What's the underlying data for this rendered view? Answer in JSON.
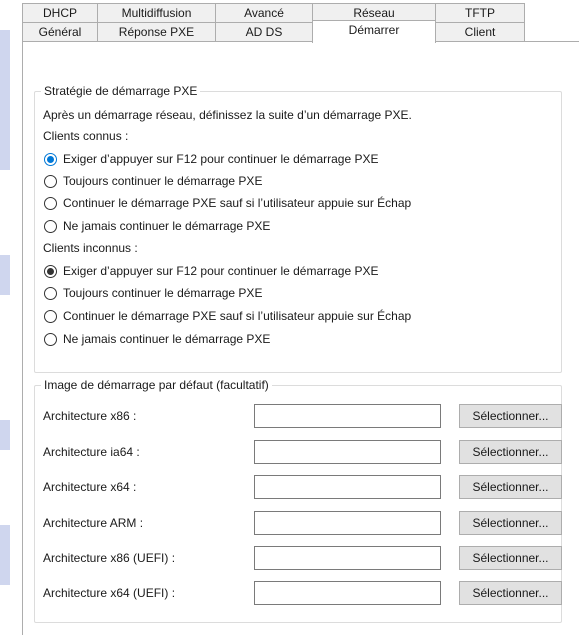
{
  "tabs": {
    "back_row": [
      "DHCP",
      "Multidiffusion",
      "Avancé",
      "Réseau",
      "TFTP"
    ],
    "front_row": [
      "Général",
      "Réponse PXE",
      "AD DS",
      "Démarrer",
      "Client"
    ],
    "selected": "Démarrer"
  },
  "pxe_strategy": {
    "title": "Stratégie de démarrage PXE",
    "description": "Après un démarrage réseau, définissez la suite d’un démarrage PXE.",
    "known_clients": {
      "label": "Clients connus :",
      "options": [
        {
          "label": "Exiger d’appuyer sur F12 pour continuer le démarrage PXE",
          "checked": true
        },
        {
          "label": "Toujours continuer le démarrage PXE",
          "checked": false
        },
        {
          "label": "Continuer le démarrage PXE sauf si l’utilisateur appuie sur Échap",
          "checked": false
        },
        {
          "label": "Ne jamais continuer le démarrage PXE",
          "checked": false
        }
      ]
    },
    "unknown_clients": {
      "label": "Clients inconnus :",
      "options": [
        {
          "label": "Exiger d’appuyer sur F12 pour continuer le démarrage PXE",
          "checked": true
        },
        {
          "label": "Toujours continuer le démarrage PXE",
          "checked": false
        },
        {
          "label": "Continuer le démarrage PXE sauf si l’utilisateur appuie sur Échap",
          "checked": false
        },
        {
          "label": "Ne jamais continuer le démarrage PXE",
          "checked": false
        }
      ]
    }
  },
  "default_image": {
    "title": "Image de démarrage par défaut (facultatif)",
    "rows": [
      {
        "label": "Architecture x86 :",
        "value": "",
        "button": "Sélectionner..."
      },
      {
        "label": "Architecture ia64 :",
        "value": "",
        "button": "Sélectionner..."
      },
      {
        "label": "Architecture x64 :",
        "value": "",
        "button": "Sélectionner..."
      },
      {
        "label": "Architecture ARM :",
        "value": "",
        "button": "Sélectionner..."
      },
      {
        "label": "Architecture x86 (UEFI) :",
        "value": "",
        "button": "Sélectionner..."
      },
      {
        "label": "Architecture x64 (UEFI) :",
        "value": "",
        "button": "Sélectionner..."
      }
    ]
  },
  "colors": {
    "accent": "#0078d7",
    "tab_background": "#f0f0f0",
    "button_background": "#e1e1e1",
    "group_border": "#dcdcdc"
  }
}
